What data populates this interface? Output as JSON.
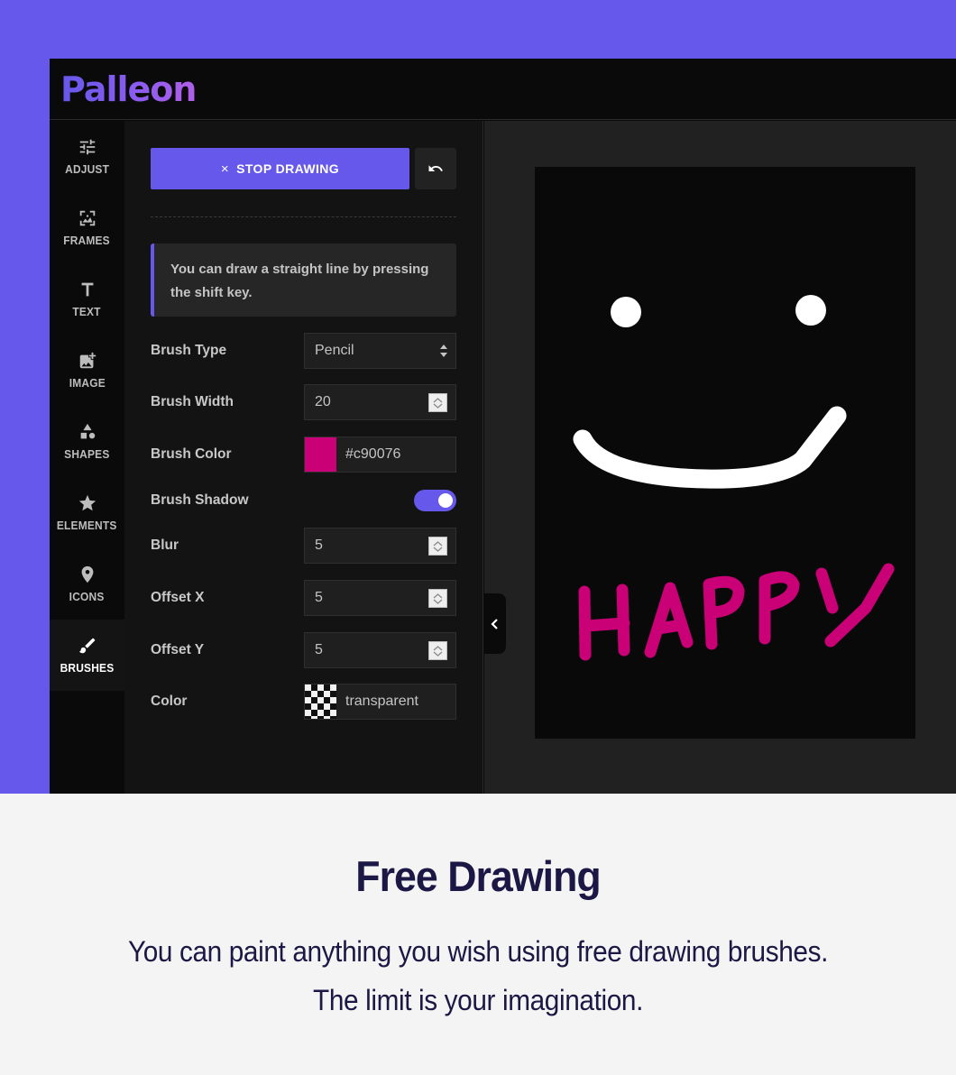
{
  "brand": {
    "name": "Palleon",
    "accent": "#6658ea"
  },
  "sidebar": {
    "items": [
      {
        "label": "ADJUST",
        "icon": "sliders-icon",
        "active": false
      },
      {
        "label": "FRAMES",
        "icon": "frame-icon",
        "active": false
      },
      {
        "label": "TEXT",
        "icon": "text-icon",
        "active": false
      },
      {
        "label": "IMAGE",
        "icon": "add-image-icon",
        "active": false
      },
      {
        "label": "SHAPES",
        "icon": "shapes-icon",
        "active": false
      },
      {
        "label": "ELEMENTS",
        "icon": "star-icon",
        "active": false
      },
      {
        "label": "ICONS",
        "icon": "map-pin-icon",
        "active": false
      },
      {
        "label": "BRUSHES",
        "icon": "brush-icon",
        "active": true
      }
    ]
  },
  "panel": {
    "stop_button": {
      "icon": "×",
      "label": "STOP DRAWING"
    },
    "undo_icon": "undo-icon",
    "notice": "You can draw a straight line by pressing the shift key.",
    "brush_type": {
      "label": "Brush Type",
      "value": "Pencil"
    },
    "brush_width": {
      "label": "Brush Width",
      "value": "20"
    },
    "brush_color": {
      "label": "Brush Color",
      "value": "#c90076",
      "swatch": "#c90076"
    },
    "brush_shadow": {
      "label": "Brush Shadow",
      "enabled": true
    },
    "blur": {
      "label": "Blur",
      "value": "5"
    },
    "offset_x": {
      "label": "Offset X",
      "value": "5"
    },
    "offset_y": {
      "label": "Offset Y",
      "value": "5"
    },
    "shadow_color": {
      "label": "Color",
      "value": "transparent"
    }
  },
  "canvas": {
    "background": "#090909",
    "drawing": {
      "face_color": "#ffffff",
      "text": "HAPPY",
      "text_color": "#c90076"
    }
  },
  "feature": {
    "title": "Free Drawing",
    "line1": "You can paint anything you wish using free drawing brushes.",
    "line2": "The limit is your imagination."
  }
}
